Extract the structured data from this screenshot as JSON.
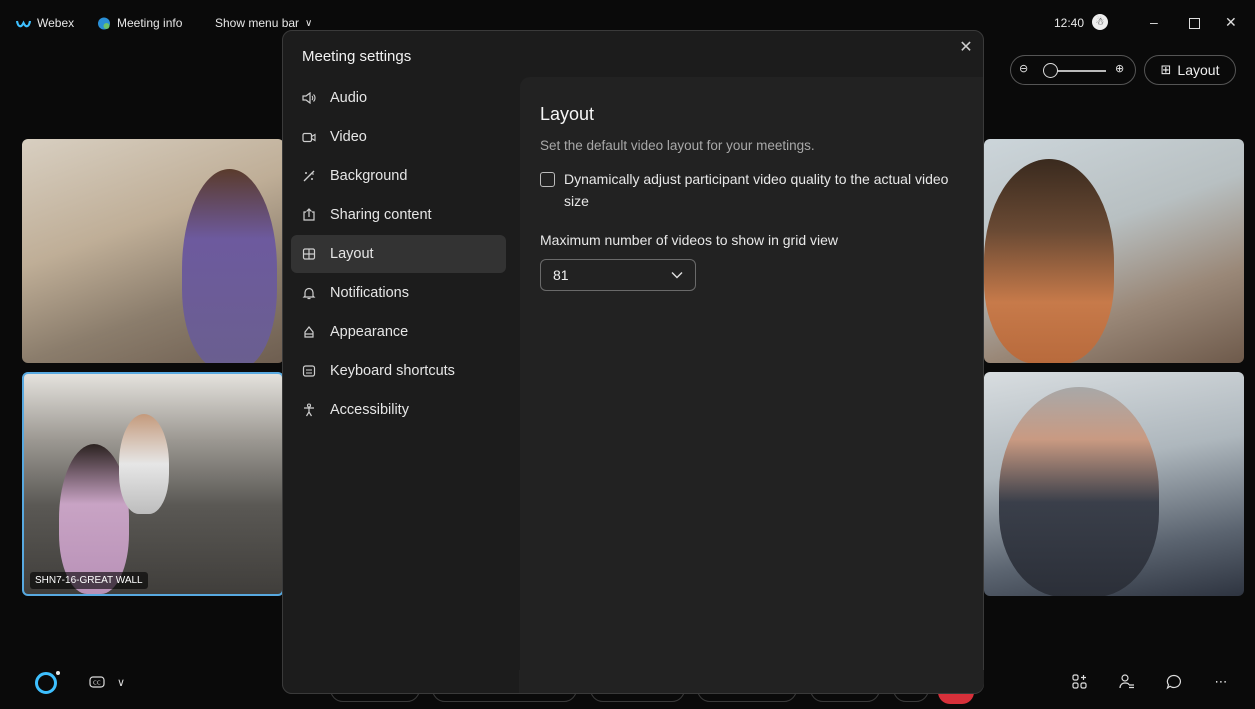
{
  "titlebar": {
    "app_name": "Webex",
    "meeting_info": "Meeting info",
    "show_menu_bar": "Show menu bar",
    "time": "12:40"
  },
  "top_controls": {
    "layout_label": "Layout"
  },
  "tiles": {
    "tile2_label": "SHN7-16-GREAT WALL"
  },
  "modal": {
    "title": "Meeting settings",
    "nav": [
      {
        "label": "Audio",
        "icon": "speaker-icon"
      },
      {
        "label": "Video",
        "icon": "camera-icon"
      },
      {
        "label": "Background",
        "icon": "magic-wand-icon"
      },
      {
        "label": "Sharing content",
        "icon": "share-icon"
      },
      {
        "label": "Layout",
        "icon": "grid-icon",
        "active": true
      },
      {
        "label": "Notifications",
        "icon": "bell-icon"
      },
      {
        "label": "Appearance",
        "icon": "paint-bucket-icon"
      },
      {
        "label": "Keyboard shortcuts",
        "icon": "keyboard-icon"
      },
      {
        "label": "Accessibility",
        "icon": "accessibility-icon"
      }
    ],
    "content": {
      "title": "Layout",
      "description": "Set the default video layout for your meetings.",
      "checkbox_label": "Dynamically adjust participant video quality to the actual video size",
      "checkbox_checked": false,
      "grid_label": "Maximum number of videos to show in grid view",
      "grid_value": "81"
    }
  },
  "colors": {
    "accent_blue": "#58a9e0",
    "webex_ring": "#3ec0ff",
    "end_call_red": "#d7303a"
  }
}
